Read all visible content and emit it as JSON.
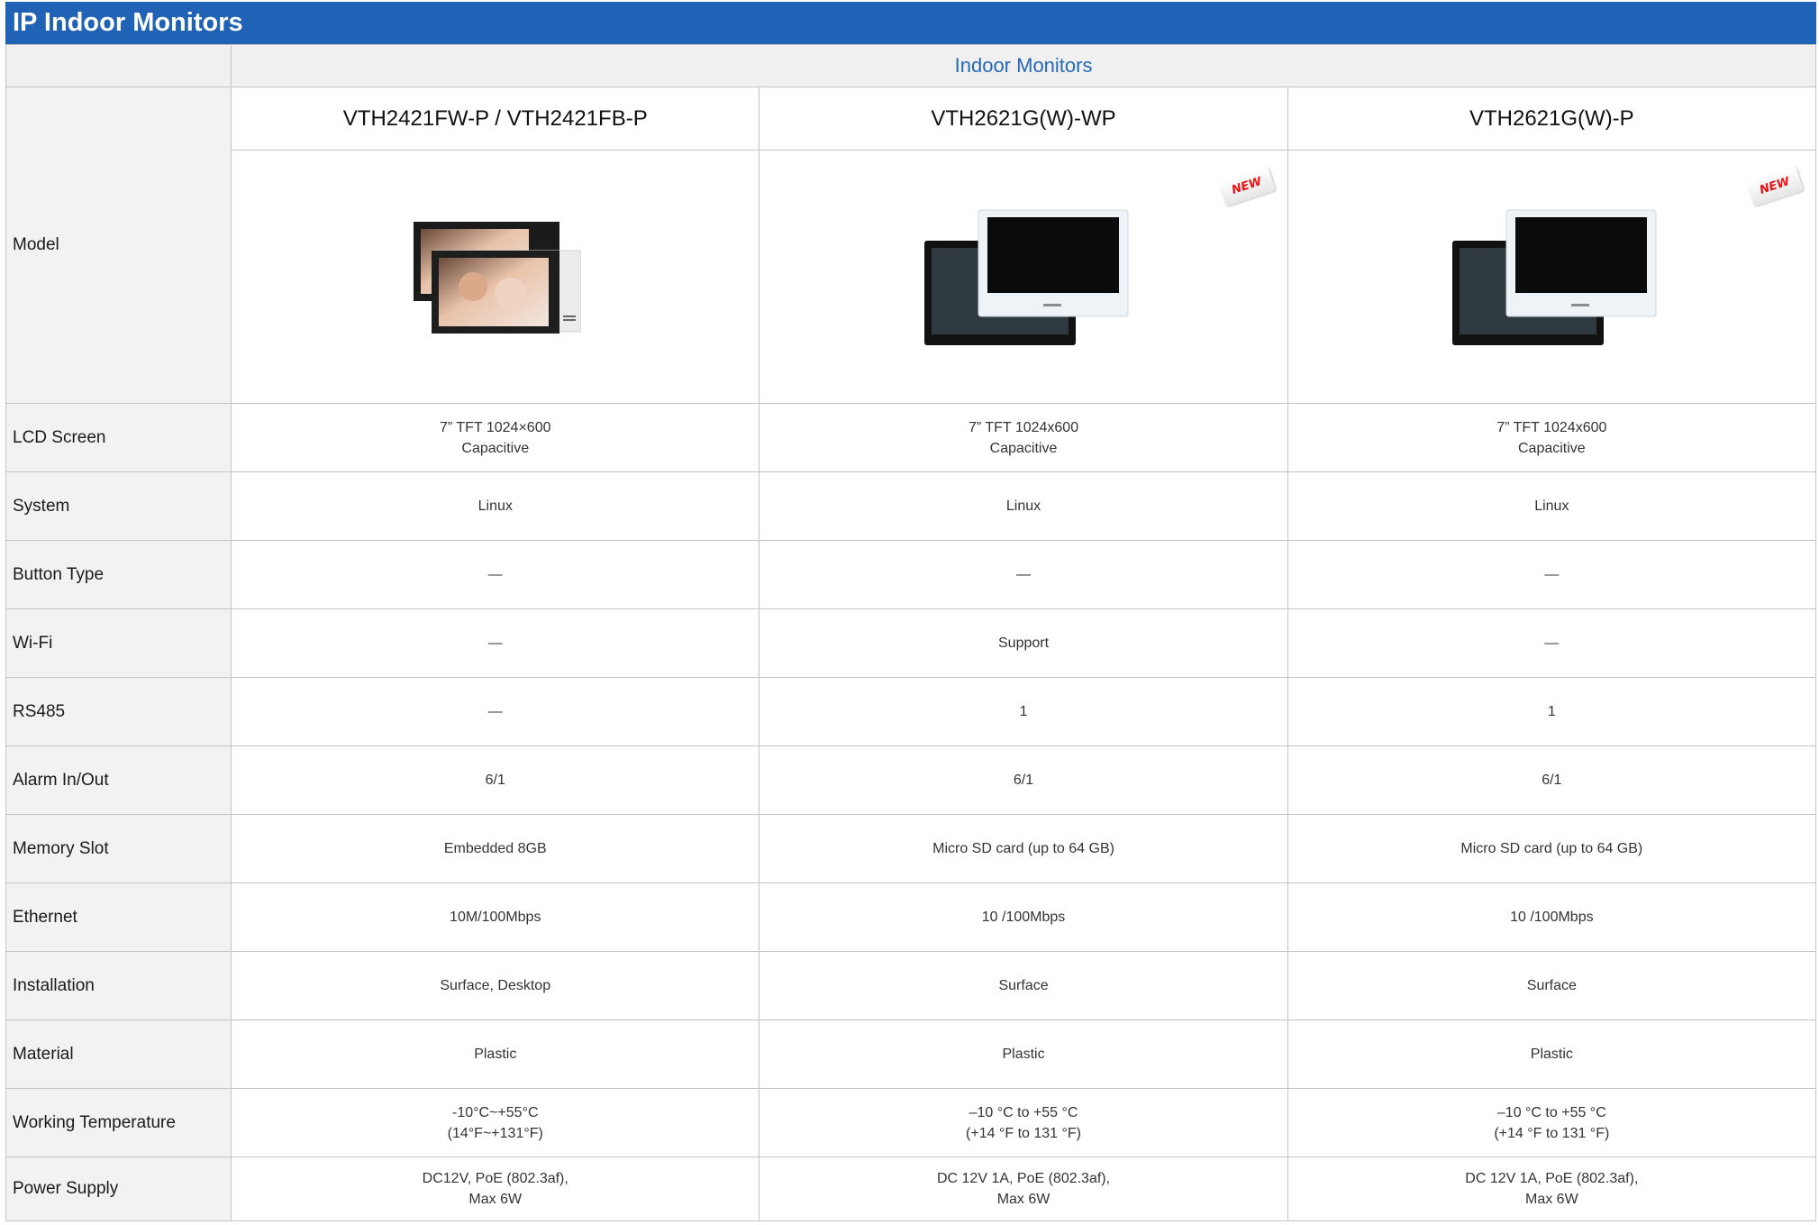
{
  "title": "IP Indoor Monitors",
  "group_header": "Indoor Monitors",
  "model_label": "Model",
  "badge_text": "NEW",
  "colors": {
    "title_bar": "#2063b6",
    "group_text": "#2668b8",
    "label_bg": "#f2f2f2",
    "badge": "#e11111"
  },
  "products": [
    {
      "name": "VTH2421FW-P / VTH2421FB-P",
      "image": "dual-monitor-black-white-with-photo",
      "is_new": false
    },
    {
      "name": "VTH2621G(W)-WP",
      "image": "dual-monitor-black-white",
      "is_new": true
    },
    {
      "name": "VTH2621G(W)-P",
      "image": "dual-monitor-black-white",
      "is_new": true
    }
  ],
  "specs": [
    {
      "label": "LCD Screen",
      "values": [
        [
          "7” TFT 1024×600",
          "Capacitive"
        ],
        [
          "7” TFT 1024x600",
          "Capacitive"
        ],
        [
          "7” TFT 1024x600",
          "Capacitive"
        ]
      ]
    },
    {
      "label": "System",
      "values": [
        [
          "Linux"
        ],
        [
          "Linux"
        ],
        [
          "Linux"
        ]
      ]
    },
    {
      "label": "Button Type",
      "values": [
        [
          "—"
        ],
        [
          "—"
        ],
        [
          "—"
        ]
      ]
    },
    {
      "label": "Wi-Fi",
      "values": [
        [
          "—"
        ],
        [
          "Support"
        ],
        [
          "—"
        ]
      ]
    },
    {
      "label": "RS485",
      "values": [
        [
          "—"
        ],
        [
          "1"
        ],
        [
          "1"
        ]
      ]
    },
    {
      "label": "Alarm In/Out",
      "values": [
        [
          "6/1"
        ],
        [
          "6/1"
        ],
        [
          "6/1"
        ]
      ]
    },
    {
      "label": "Memory Slot",
      "values": [
        [
          "Embedded 8GB"
        ],
        [
          "Micro SD card (up to 64 GB)"
        ],
        [
          "Micro SD card (up to 64 GB)"
        ]
      ]
    },
    {
      "label": "Ethernet",
      "values": [
        [
          "10M/100Mbps"
        ],
        [
          "10 /100Mbps"
        ],
        [
          "10 /100Mbps"
        ]
      ]
    },
    {
      "label": "Installation",
      "values": [
        [
          "Surface, Desktop"
        ],
        [
          "Surface"
        ],
        [
          "Surface"
        ]
      ]
    },
    {
      "label": "Material",
      "values": [
        [
          "Plastic"
        ],
        [
          "Plastic"
        ],
        [
          "Plastic"
        ]
      ]
    },
    {
      "label": "Working Temperature",
      "values": [
        [
          "-10°C~+55°C",
          "(14°F~+131°F)"
        ],
        [
          "–10 °C to +55 °C",
          "(+14 °F to 131 °F)"
        ],
        [
          "–10 °C to +55 °C",
          "(+14 °F to 131 °F)"
        ]
      ]
    },
    {
      "label": "Power Supply",
      "values": [
        [
          "DC12V, PoE (802.3af),",
          "Max 6W"
        ],
        [
          "DC 12V 1A, PoE (802.3af),",
          "Max 6W"
        ],
        [
          "DC 12V 1A, PoE (802.3af),",
          "Max 6W"
        ]
      ]
    }
  ]
}
